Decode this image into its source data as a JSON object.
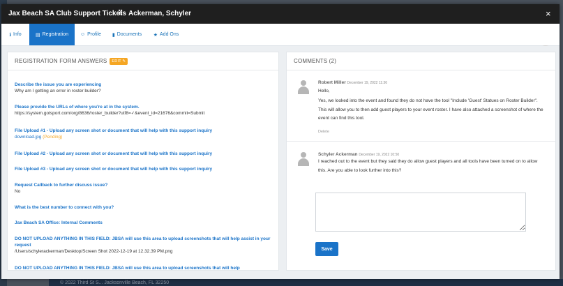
{
  "modal": {
    "title": "Jax Beach SA Club Support Tickets",
    "drag_glyph": "⠿",
    "subject": "Ackerman, Schyler",
    "close_glyph": "×"
  },
  "tabs": [
    {
      "label": "Info",
      "icon": "info-icon",
      "glyph": "ℹ",
      "active": false
    },
    {
      "label": "Registration",
      "icon": "document-icon",
      "glyph": "▤",
      "active": true
    },
    {
      "label": "Profile",
      "icon": "profile-icon",
      "glyph": "☺",
      "active": false
    },
    {
      "label": "Documents",
      "icon": "file-icon",
      "glyph": "▮",
      "active": false
    },
    {
      "label": "Add Ons",
      "icon": "star-icon",
      "glyph": "★",
      "active": false
    }
  ],
  "registration": {
    "title": "REGISTRATION FORM ANSWERS",
    "edit_label": "EDIT ✎",
    "items": [
      {
        "q": "Describe the issue you are experiencing",
        "a": "Why am I getting an error in roster builder?"
      },
      {
        "q": "Please provide the URLs of where you're at in the system.",
        "a": "https://system.gotsport.com/org/8636/roster_builder?utf8=✓&event_id=21676&commit=Submit"
      },
      {
        "q": "File Upload #1 - Upload any screen shot or document that will help with this support inquiry",
        "a": "download.jpg",
        "a_extra": "(Pending)"
      },
      {
        "q": "File Upload #2 - Upload any screen shot or document that will help with this support inquiry",
        "a": ""
      },
      {
        "q": "File Upload #3 - Upload any screen shot or document that will help with this support inquiry",
        "a": ""
      },
      {
        "q": "Request Callback to further discuss issue?",
        "a": "No"
      },
      {
        "q": "What is the best number to connect with you?",
        "a": ""
      },
      {
        "q": "Jax Beach SA Office: Internal Comments",
        "a": ""
      },
      {
        "q": "DO NOT UPLOAD ANYTHING IN THIS FIELD: JBSA will use this area to upload screenshots that will help assist in your request",
        "a": "/Users/schyleracker​man/Desktop/Screen Shot 2022-12-19 at 12.32.39 PM.png"
      },
      {
        "q": "DO NOT UPLOAD ANYTHING IN THIS FIELD: JBSA will use this area to upload screenshots that will help",
        "a": ""
      }
    ]
  },
  "comments": {
    "title": "COMMENTS (2)",
    "items": [
      {
        "author": "Robert Miller",
        "date": "December 19, 2022 11:36",
        "lines": [
          "Hello,",
          "Yes, we looked into the event and found they do not have the tool \"Include 'Guest' Statues on Roster Builder\". This will allow you to then add guest players to your event roster. I have also attached a screenshot of where the event can find this tool."
        ],
        "delete_label": "Delete"
      },
      {
        "author": "Schyler Ackerman",
        "date": "December 19, 2022 10:50",
        "lines": [
          "I reached out to the event but they said they do allow guest players and all tools have been turned on to allow this. Are you able to look further into this?"
        ]
      }
    ],
    "reply_value": "",
    "save_label": "Save"
  },
  "background": {
    "footer_text": "© 2022 Third St S... Jacksonville Beach, FL 32250"
  }
}
